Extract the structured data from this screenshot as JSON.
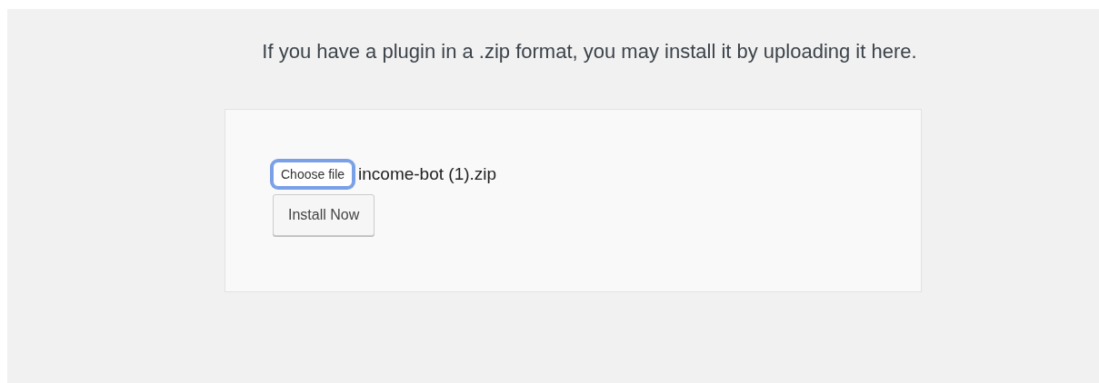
{
  "description": "If you have a plugin in a .zip format, you may install it by uploading it here.",
  "upload_form": {
    "file_button": {
      "label": "Choose file",
      "focused": true
    },
    "file_name": "income-bot (1).zip",
    "submit_button": {
      "label": "Install Now"
    }
  }
}
